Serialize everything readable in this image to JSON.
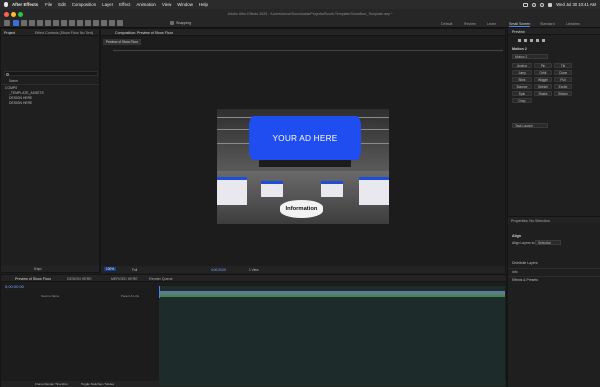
{
  "menubar": {
    "app": "After Effects",
    "items": [
      "File",
      "Edit",
      "Composition",
      "Layer",
      "Effect",
      "Animation",
      "View",
      "Window",
      "Help"
    ],
    "clock": "Wed Jul 30 10:41 AM"
  },
  "window_title": "Adobe After Effects 2025 - /Users/stone/Downloads/Projects/Booth-Template/Showfloor_Template.aep *",
  "toolbar": {
    "snapping_label": "Snapping",
    "workspaces": [
      "Default",
      "Review",
      "Learn",
      "Small Screen",
      "Standard",
      "Libraries"
    ],
    "active_workspace": "Small Screen"
  },
  "project_panel": {
    "tabs": [
      "Project",
      "Effect Controls (Show Floor No Text)"
    ],
    "search_placeholder": "",
    "column_name": "Name",
    "items": [
      "COMPS",
      "_TEMPLATE_ASSETS",
      "DESIGN HERE",
      "DESIGN HERE"
    ]
  },
  "footer_left": {
    "bpc": "8 bpc"
  },
  "viewer": {
    "tab": "Composition: Preview of Show Floor",
    "subtab": "Preview of Show Floor",
    "ad_text": "YOUR AD HERE",
    "info_text": "Information",
    "zoom": "100%",
    "resolution": "Full",
    "time": "0;00;00;00",
    "camera": "1 View",
    "active_camera": "Active Camera"
  },
  "timeline": {
    "tabs": [
      "Preview of Show Floor",
      "DESIGN HERE",
      "MERGED HERE",
      "Render Queue"
    ],
    "timecode": "0;00;00;00",
    "col_source": "Source Name",
    "col_parent": "Parent & Link",
    "footer_render": "Frame Render Time",
    "footer_render_value": "0ms",
    "footer_toggle": "Toggle Switches / Modes"
  },
  "right_panel": {
    "preview_tab": "Preview",
    "motion_tab": "Motion 2",
    "motion_dropdown": "Motion 2",
    "motion_options": [
      "Anchor",
      "Pin",
      "Tilt",
      "Jump",
      "Orbit",
      "Clone",
      "Blink",
      "Wiggle",
      "Pull",
      "Bounce",
      "Stretch",
      "Excite",
      "Spin",
      "Shake",
      "Sticker",
      "Drop"
    ],
    "task_dropdown": "Task Launch",
    "properties_tab": "Properties: No Selection",
    "align_tab": "Align",
    "align_layers_to": "Align Layers to:",
    "align_target": "Selection",
    "distribute_layers": "Distribute Layers:",
    "info_item": "Info",
    "effects_item": "Effects & Presets"
  },
  "colors": {
    "accent": "#4d82e8",
    "ad_blue": "#1f4df0",
    "panel_bg": "#1f1f1f"
  }
}
